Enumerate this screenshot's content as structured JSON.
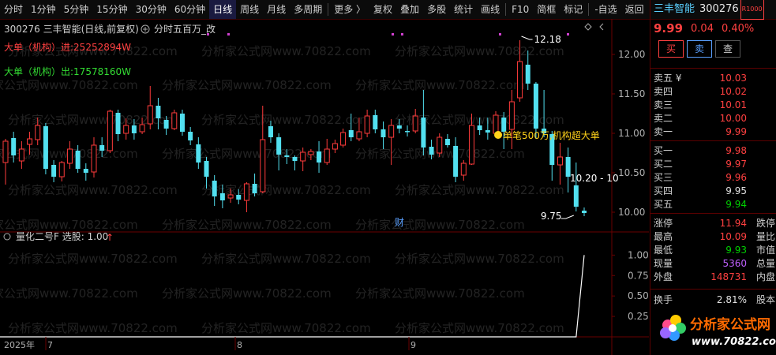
{
  "toolbar": {
    "items": [
      "分时",
      "1分钟",
      "5分钟",
      "15分钟",
      "30分钟",
      "60分钟",
      "日线",
      "周线",
      "月线",
      "多周期",
      "更多 〉",
      "复权",
      "叠加",
      "多股",
      "统计",
      "画线",
      "F10",
      "简框",
      "标记",
      "-自选",
      "返回"
    ],
    "active": "日线"
  },
  "chart_header": {
    "stock": "300276 三丰智能(日线,前复权)",
    "indicator": "分时五百万_改",
    "big_in": "大单（机构）进:25252894W",
    "big_out": "大单（机构）出:17578160W"
  },
  "sub_header": {
    "label": "量化二号F 选股: 1.00",
    "arrow": "↑"
  },
  "chart_data": [
    {
      "type": "candlestick",
      "y_ticks": [
        "12.00",
        "11.50",
        "11.00",
        "10.50",
        "10.00"
      ],
      "ylim": [
        9.7,
        12.3
      ],
      "annotations": {
        "high": "12.18",
        "low": "9.75",
        "signal": "单笔500万,机构超大单",
        "level": "10.20 - 10",
        "finance": "财"
      },
      "candles": [
        [
          10.63,
          10.9,
          10.35,
          10.93
        ],
        [
          10.94,
          10.72,
          10.63,
          11.02
        ],
        [
          10.65,
          10.8,
          10.55,
          10.9
        ],
        [
          10.86,
          10.93,
          10.73,
          11.02
        ],
        [
          10.92,
          11.1,
          10.85,
          11.2
        ],
        [
          11.09,
          10.55,
          10.48,
          11.13
        ],
        [
          10.6,
          10.45,
          10.38,
          10.66
        ],
        [
          10.45,
          10.63,
          10.39,
          10.65
        ],
        [
          10.62,
          10.8,
          10.55,
          10.9
        ],
        [
          10.78,
          10.55,
          10.5,
          10.85
        ],
        [
          10.55,
          10.5,
          10.4,
          10.62
        ],
        [
          10.51,
          10.85,
          10.44,
          10.95
        ],
        [
          10.85,
          10.78,
          10.7,
          10.95
        ],
        [
          10.78,
          11.28,
          10.75,
          11.3
        ],
        [
          11.26,
          10.99,
          10.9,
          11.3
        ],
        [
          11.0,
          11.1,
          10.92,
          11.19
        ],
        [
          11.1,
          11.0,
          10.92,
          11.18
        ],
        [
          11.02,
          11.11,
          10.99,
          11.2
        ],
        [
          11.12,
          11.35,
          11.05,
          11.6
        ],
        [
          11.35,
          11.19,
          11.05,
          11.45
        ],
        [
          11.17,
          11.06,
          10.98,
          11.22
        ],
        [
          11.06,
          11.26,
          11.04,
          11.3
        ],
        [
          11.25,
          11.02,
          10.97,
          11.3
        ],
        [
          11.02,
          10.91,
          10.85,
          11.08
        ],
        [
          10.86,
          10.63,
          10.55,
          10.95
        ],
        [
          10.65,
          10.45,
          10.3,
          10.7
        ],
        [
          10.4,
          10.2,
          10.08,
          10.47
        ],
        [
          10.24,
          10.15,
          10.05,
          10.35
        ],
        [
          10.18,
          10.22,
          10.12,
          10.3
        ],
        [
          10.22,
          10.16,
          10.1,
          10.29
        ],
        [
          10.15,
          10.36,
          10.0,
          10.38
        ],
        [
          10.36,
          10.24,
          10.2,
          10.49
        ],
        [
          10.26,
          10.92,
          10.24,
          11.35
        ],
        [
          11.09,
          10.95,
          10.88,
          11.16
        ],
        [
          10.95,
          10.73,
          10.53,
          11.0
        ],
        [
          10.72,
          10.7,
          10.61,
          10.8
        ],
        [
          10.7,
          10.65,
          10.53,
          10.72
        ],
        [
          10.65,
          10.76,
          10.52,
          10.82
        ],
        [
          10.73,
          10.77,
          10.66,
          10.8
        ],
        [
          10.77,
          10.63,
          10.5,
          10.9
        ],
        [
          10.63,
          10.8,
          10.6,
          10.93
        ],
        [
          10.8,
          10.87,
          10.75,
          10.92
        ],
        [
          10.85,
          11.01,
          10.82,
          11.06
        ],
        [
          11.04,
          10.95,
          10.9,
          11.25
        ],
        [
          10.93,
          11.02,
          10.9,
          11.2
        ],
        [
          11.0,
          11.22,
          10.95,
          11.3
        ],
        [
          11.23,
          11.05,
          11.0,
          11.3
        ],
        [
          11.05,
          10.95,
          10.8,
          11.15
        ],
        [
          10.95,
          11.1,
          10.6,
          11.18
        ],
        [
          11.1,
          11.06,
          11.0,
          11.18
        ],
        [
          11.03,
          11.02,
          10.96,
          11.1
        ],
        [
          11.03,
          11.22,
          11.0,
          11.31
        ],
        [
          11.2,
          10.82,
          10.72,
          11.55
        ],
        [
          10.83,
          10.73,
          10.67,
          10.92
        ],
        [
          10.75,
          10.95,
          10.7,
          11.0
        ],
        [
          10.93,
          10.85,
          10.82,
          10.99
        ],
        [
          10.84,
          10.45,
          10.38,
          10.95
        ],
        [
          10.47,
          10.62,
          10.4,
          10.66
        ],
        [
          10.61,
          11.1,
          10.6,
          11.25
        ],
        [
          11.1,
          11.04,
          10.98,
          11.2
        ],
        [
          11.04,
          11.01,
          10.92,
          11.2
        ],
        [
          11.0,
          11.23,
          10.95,
          11.28
        ],
        [
          11.2,
          11.02,
          10.8,
          11.27
        ],
        [
          11.05,
          11.4,
          10.8,
          11.55
        ],
        [
          11.45,
          11.91,
          11.4,
          12.18
        ],
        [
          11.87,
          11.63,
          11.55,
          12.05
        ],
        [
          11.63,
          11.06,
          10.93,
          11.65
        ],
        [
          11.06,
          11.0,
          10.95,
          11.55
        ],
        [
          10.99,
          10.6,
          10.4,
          11.03
        ],
        [
          10.6,
          10.7,
          10.35,
          10.88
        ],
        [
          10.7,
          10.45,
          10.25,
          10.82
        ],
        [
          10.34,
          10.07,
          10.01,
          10.63
        ],
        [
          10.02,
          9.99,
          9.95,
          10.06
        ]
      ]
    },
    {
      "type": "line",
      "y_ticks": [
        "1.00",
        "0.75",
        "0.50",
        "0.25"
      ],
      "ylim": [
        0,
        1.1
      ],
      "values": [
        0,
        0,
        0,
        0,
        0,
        0,
        0,
        0,
        0,
        0,
        0,
        0,
        0,
        0,
        0,
        0,
        0,
        0,
        0,
        0,
        0,
        0,
        0,
        0,
        0,
        0,
        0,
        0,
        0,
        0,
        0,
        0,
        0,
        0,
        0,
        0,
        0,
        0,
        0,
        0,
        0,
        0,
        0,
        0,
        0,
        0,
        0,
        0,
        0,
        0,
        0,
        0,
        0,
        0,
        0,
        0,
        0,
        0,
        0,
        0,
        0,
        0,
        0,
        0,
        0,
        0,
        0,
        0,
        0,
        0,
        0,
        0,
        1.0
      ]
    }
  ],
  "x_axis": {
    "year": "2025年",
    "months": [
      "7",
      "8",
      "9"
    ]
  },
  "watermark": "分析家公式网www.70822.com",
  "quote": {
    "name": "三丰智能",
    "code": "300276",
    "badge": "R1000",
    "price": "9.99",
    "change": "0.04",
    "pct": "0.40%",
    "buy_btn": "买",
    "sell_btn": "卖",
    "query_btn": "查",
    "asks": [
      {
        "label": "卖五 ¥",
        "price": "10.03",
        "color": "red"
      },
      {
        "label": "卖四",
        "price": "10.02",
        "color": "red"
      },
      {
        "label": "卖三",
        "price": "10.01",
        "color": "red"
      },
      {
        "label": "卖二",
        "price": "10.00",
        "color": "red"
      },
      {
        "label": "卖一",
        "price": "9.99",
        "color": "red"
      }
    ],
    "bids": [
      {
        "label": "买一",
        "price": "9.98",
        "color": "red"
      },
      {
        "label": "买二",
        "price": "9.97",
        "color": "red"
      },
      {
        "label": "买三",
        "price": "9.96",
        "color": "red"
      },
      {
        "label": "买四",
        "price": "9.95",
        "color": "white"
      },
      {
        "label": "买五",
        "price": "9.94",
        "color": "green"
      }
    ],
    "stats": [
      {
        "label": "涨停",
        "value": "11.94",
        "color": "red",
        "extra": "跌停"
      },
      {
        "label": "最高",
        "value": "10.09",
        "color": "red",
        "extra": "量比"
      },
      {
        "label": "最低",
        "value": "9.93",
        "color": "green",
        "extra": "市值"
      },
      {
        "label": "现量",
        "value": "5360",
        "color": "purple",
        "extra": "总量"
      },
      {
        "label": "外盘",
        "value": "148731",
        "color": "red",
        "extra": "内盘"
      }
    ],
    "turnover": {
      "label": "换手",
      "value": "2.81%",
      "extra": "股本"
    }
  },
  "logo": {
    "text": "分析家公式网",
    "url": "www.70822.com"
  }
}
